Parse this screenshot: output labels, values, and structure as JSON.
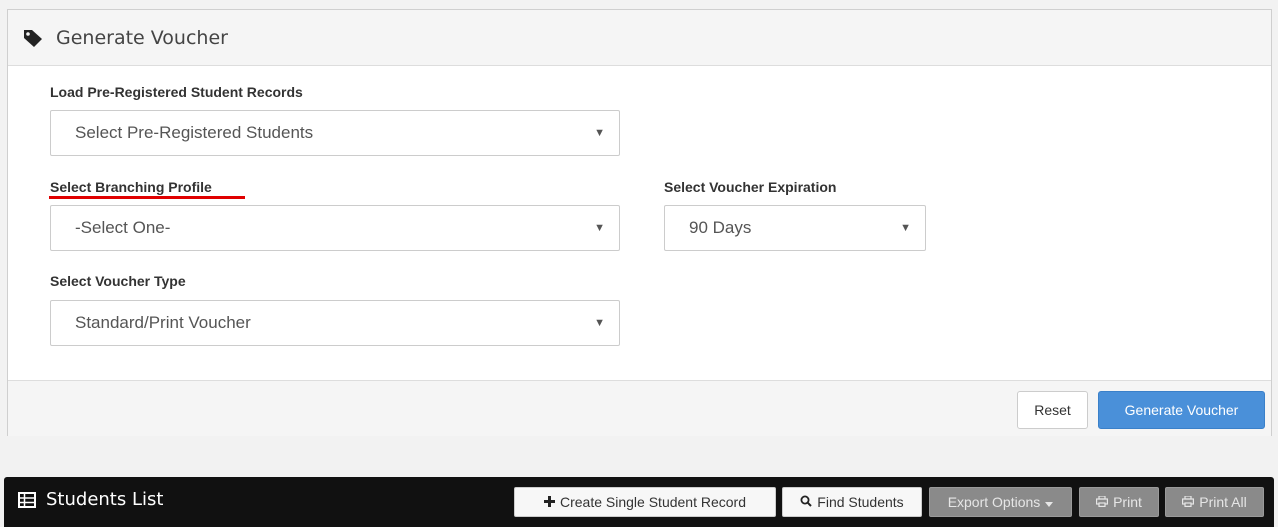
{
  "panel": {
    "title": "Generate Voucher",
    "icon": "tag-icon"
  },
  "form": {
    "pre_registered": {
      "label": "Load Pre-Registered Student Records",
      "value": "Select Pre-Registered Students"
    },
    "branching_profile": {
      "label": "Select Branching Profile",
      "value": "-Select One-"
    },
    "voucher_expiration": {
      "label": "Select Voucher Expiration",
      "value": "90 Days"
    },
    "voucher_type": {
      "label": "Select Voucher Type",
      "value": "Standard/Print Voucher"
    },
    "caret": "▼"
  },
  "footer": {
    "reset_label": "Reset",
    "generate_label": "Generate Voucher"
  },
  "students": {
    "title": "Students List",
    "icon": "table-icon",
    "create_label": "Create Single Student Record",
    "find_label": "Find Students",
    "export_label": "Export Options",
    "print_label": "Print",
    "print_all_label": "Print All"
  },
  "colors": {
    "primary": "#4a90d9",
    "highlight_underline": "#e00000",
    "bar": "#111111"
  }
}
